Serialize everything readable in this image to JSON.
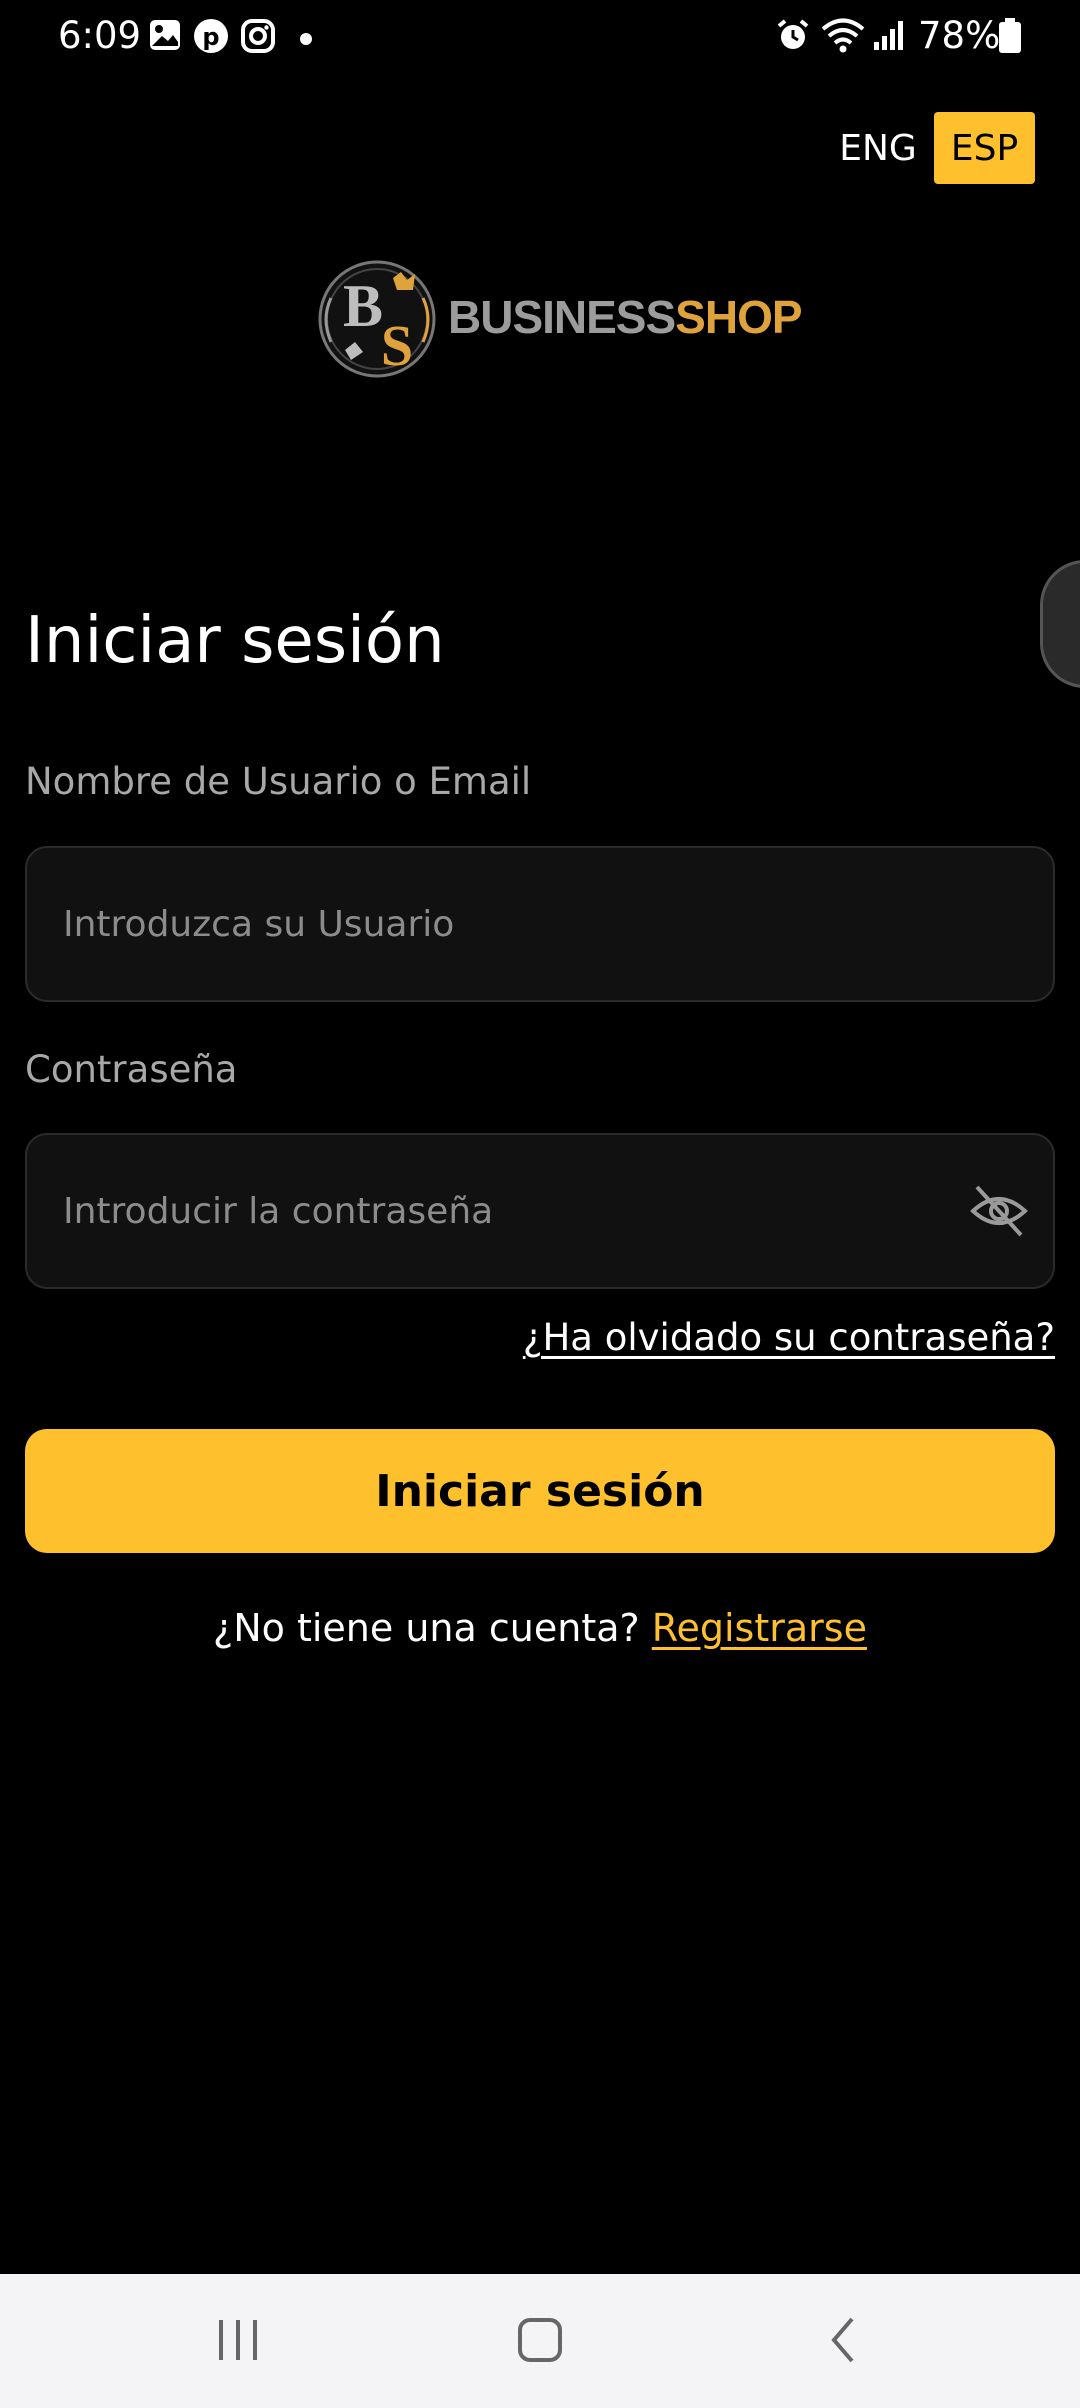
{
  "status_bar": {
    "time": "6:09",
    "battery": "78%",
    "icons": [
      "gallery-icon",
      "pinterest-icon",
      "instagram-icon",
      "dot-icon",
      "alarm-icon",
      "wifi-icon",
      "signal-icon",
      "battery-icon"
    ]
  },
  "language": {
    "eng": "ENG",
    "esp": "ESP",
    "selected": "ESP",
    "accent": "#FEC02C"
  },
  "logo": {
    "word1": "BUSINESS",
    "word2": "SHOP",
    "monogram_b": "B",
    "monogram_s": "S"
  },
  "login": {
    "title": "Iniciar sesión",
    "username_label": "Nombre de Usuario o Email",
    "username_value": "",
    "username_placeholder": "Introduzca su Usuario",
    "password_label": "Contraseña",
    "password_value": "",
    "password_placeholder": "Introducir la contraseña",
    "forgot_link": "¿Ha olvidado su contraseña?",
    "submit_label": "Iniciar sesión",
    "no_account_text": "¿No tiene una cuenta?",
    "register_link": "Registrarse"
  },
  "nav_bar": {
    "icons": [
      "recent-apps-icon",
      "home-icon",
      "back-icon"
    ]
  }
}
